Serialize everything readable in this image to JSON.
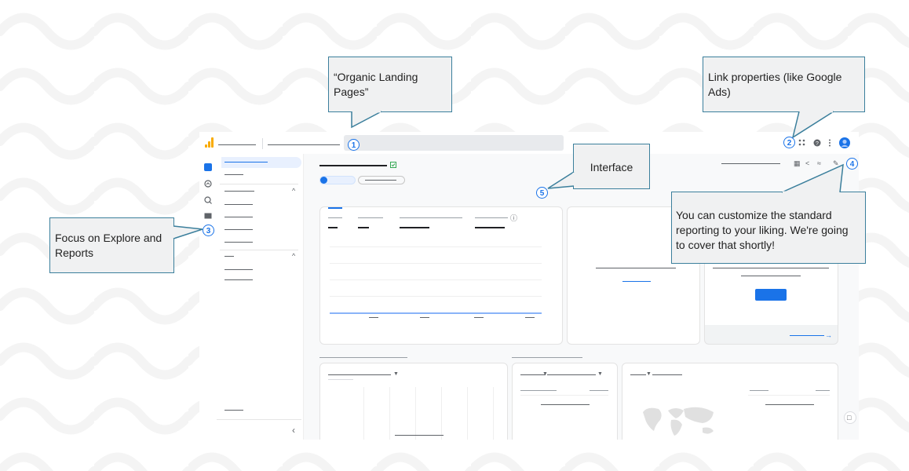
{
  "callouts": {
    "one": {
      "badge": "1",
      "text": "“Organic Landing Pages”"
    },
    "two": {
      "badge": "2",
      "text": "Link properties (like Google Ads)"
    },
    "three": {
      "badge": "3",
      "text": "Focus on Explore and Reports"
    },
    "four": {
      "badge": "4",
      "text": "You can customize the standard reporting to your liking. We're going to cover that shortly!"
    },
    "five": {
      "badge": "5",
      "text": "Interface"
    }
  },
  "icons": {
    "apps": "apps-grid-icon",
    "help": "help-icon",
    "more": "more-vert-icon",
    "account": "account-avatar-icon",
    "settings": "gear-icon",
    "collapse": "chevron-left-icon",
    "feedback": "feedback-icon",
    "share": "share-icon",
    "insights": "insights-icon",
    "edit": "pencil-icon",
    "customize": "customize-report-icon"
  },
  "colors": {
    "accent": "#1a73e8",
    "brand": "#f9ab00",
    "callout_border": "#3b7f9c",
    "callout_fill": "#f0f1f2"
  }
}
